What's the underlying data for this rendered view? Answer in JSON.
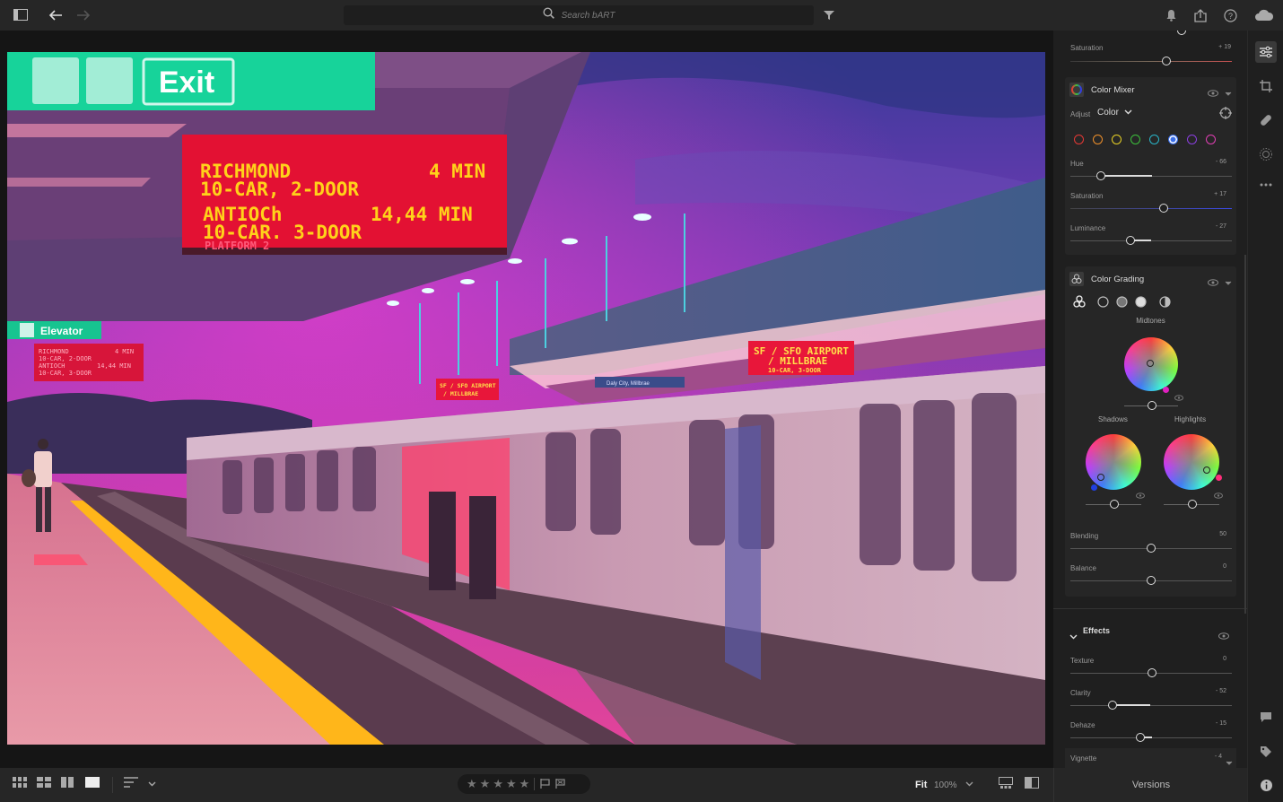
{
  "search": {
    "placeholder": "Search bART"
  },
  "photo": {
    "signs": {
      "exit": "Exit",
      "main_lines": [
        "RICHMOND",
        "10-CAR, 2-DOOR",
        "ANTIOCh",
        "10-CAR. 3-DOOR"
      ],
      "main_times": [
        "4 MIN",
        "14,44 MIN"
      ],
      "main_platform": "PLATFORM 2",
      "elevator": "Elevator",
      "left_small": [
        "RICHMOND",
        "10-CAR, 2-DOOR",
        "ANTIOCH",
        "10-CAR, 3-DOOR"
      ],
      "left_small_times": [
        "4 MIN",
        "14,44 MIN"
      ],
      "sfo_right": [
        "SF / SFO AIRPORT",
        "/ MILLBRAE",
        "10-CAR, 3-DOOR"
      ],
      "sfo_mid": [
        "SF / SFO AIRPORT",
        "/ MILLBRAE"
      ],
      "daly": "Daly City, Millbrae"
    }
  },
  "panel": {
    "top_saturation": {
      "label": "Saturation",
      "value": "+ 19"
    },
    "color_mixer": {
      "title": "Color Mixer",
      "adjust_label": "Adjust",
      "adjust_value": "Color",
      "swatches": [
        "#e53935",
        "#f0902a",
        "#e8d125",
        "#3cc03c",
        "#2ab5c8",
        "#3b6fe8",
        "#8a3fe0",
        "#e03fb4"
      ],
      "selected_swatch": 5,
      "sliders": [
        {
          "label": "Hue",
          "value": "- 66"
        },
        {
          "label": "Saturation",
          "value": "+ 17"
        },
        {
          "label": "Luminance",
          "value": "- 27"
        }
      ]
    },
    "color_grading": {
      "title": "Color Grading",
      "midtones": "Midtones",
      "shadows": "Shadows",
      "highlights": "Highlights",
      "sliders": [
        {
          "label": "Blending",
          "value": "50"
        },
        {
          "label": "Balance",
          "value": "0"
        }
      ]
    },
    "effects": {
      "title": "Effects",
      "sliders": [
        {
          "label": "Texture",
          "value": "0"
        },
        {
          "label": "Clarity",
          "value": "- 52"
        },
        {
          "label": "Dehaze",
          "value": "- 15"
        },
        {
          "label": "Vignette",
          "value": "- 4"
        }
      ]
    }
  },
  "bottom": {
    "fit_label": "Fit",
    "zoom": "100%",
    "versions": "Versions",
    "stars": [
      "★",
      "★",
      "★",
      "★",
      "★"
    ]
  }
}
